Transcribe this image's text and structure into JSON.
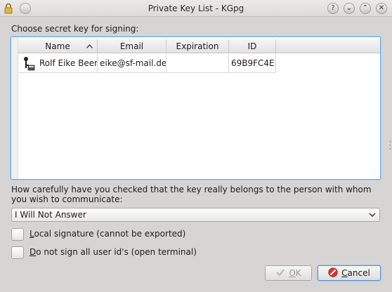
{
  "window": {
    "title": "Private Key List - KGpg",
    "help_button": "?",
    "min_button": "⌄",
    "max_button": "⌃",
    "close_button": "✕"
  },
  "label_choose": "Choose secret key for signing:",
  "table": {
    "columns": [
      "Name",
      "Email",
      "Expiration",
      "ID"
    ],
    "rows": [
      {
        "name": "Rolf Eike Beer",
        "email": "eike@sf-mail.de",
        "expiration": "",
        "id": "69B9FC4E"
      }
    ]
  },
  "question": "How carefully have you checked that the key really belongs to the person with whom you wish to communicate:",
  "trust_select": {
    "value": "I Will Not Answer"
  },
  "checkboxes": [
    {
      "mnemonic": "L",
      "rest": "ocal signature (cannot be exported)",
      "checked": false
    },
    {
      "mnemonic": "D",
      "rest": "o not sign all user id's (open terminal)",
      "checked": false
    }
  ],
  "buttons": {
    "ok_mnemonic": "O",
    "ok_rest": "K",
    "cancel_mnemonic": "C",
    "cancel_rest": "ancel"
  },
  "colors": {
    "accent": "#6aa9e0",
    "cancel_icon": "#d9342b",
    "ok_icon": "#b8b7b6"
  }
}
